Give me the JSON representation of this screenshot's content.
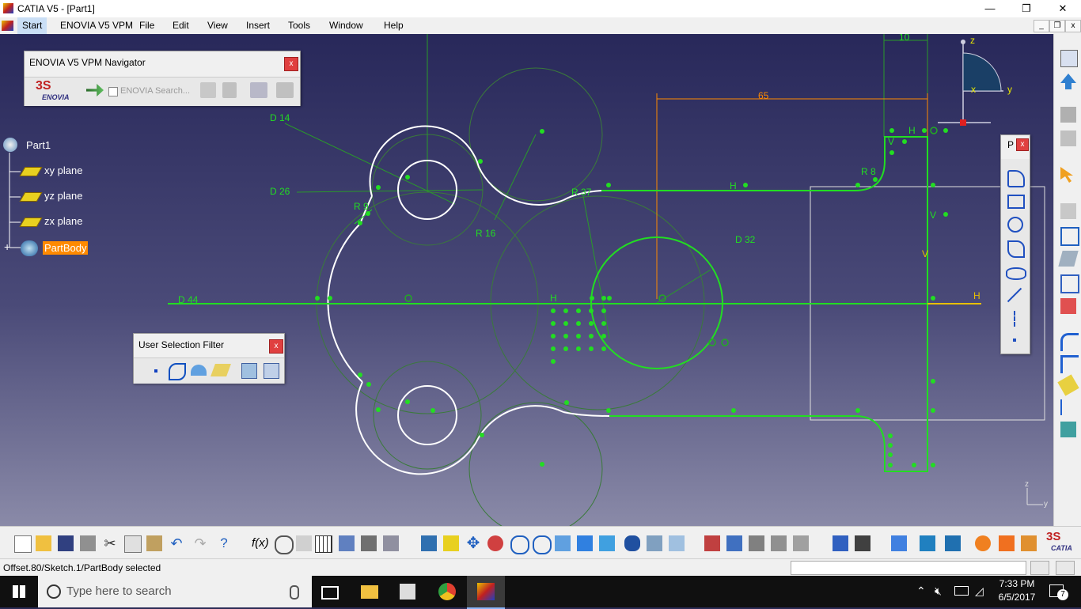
{
  "window": {
    "title": "CATIA V5 - [Part1]",
    "min": "—",
    "max": "❐",
    "close": "✕"
  },
  "menubar": {
    "items": [
      "Start",
      "ENOVIA V5 VPM",
      "File",
      "Edit",
      "View",
      "Insert",
      "Tools",
      "Window",
      "Help"
    ],
    "mdi": [
      "_",
      "❐",
      "x"
    ]
  },
  "enovia_panel": {
    "title": "ENOVIA V5 VPM Navigator",
    "logo_text": "ENOVIA",
    "search_label": "ENOVIA Search...",
    "close": "x"
  },
  "tree": {
    "root": "Part1",
    "items": [
      "xy plane",
      "yz plane",
      "zx plane"
    ],
    "selected": "PartBody"
  },
  "selection_filter": {
    "title": "User Selection Filter",
    "close": "x"
  },
  "profile_panel": {
    "title": "P",
    "close": "x"
  },
  "sketch": {
    "dimensions": {
      "d14": "D 14",
      "d26": "D 26",
      "r9": "R 9",
      "r16": "R 16",
      "r37": "R 37",
      "d32": "D 32",
      "d44": "D 44",
      "r8": "R 8",
      "d65": "65",
      "d10": "10"
    },
    "constraints": {
      "h": "H",
      "v": "V"
    },
    "axis": {
      "h": "H",
      "v": "V"
    },
    "compass": {
      "z": "z",
      "x": "x",
      "y": "y"
    },
    "corner_axis": {
      "z": "z",
      "y": "y"
    }
  },
  "statusbar": {
    "message": "Offset.80/Sketch.1/PartBody selected"
  },
  "taskbar": {
    "search_placeholder": "Type here to search",
    "time": "7:33 PM",
    "date": "6/5/2017",
    "notification_count": "7"
  },
  "colors": {
    "canvas_top": "#28285a",
    "sketch_green": "#22dd22",
    "dimension_orange": "#ff8a00",
    "selected_orange": "#ff8a00"
  }
}
